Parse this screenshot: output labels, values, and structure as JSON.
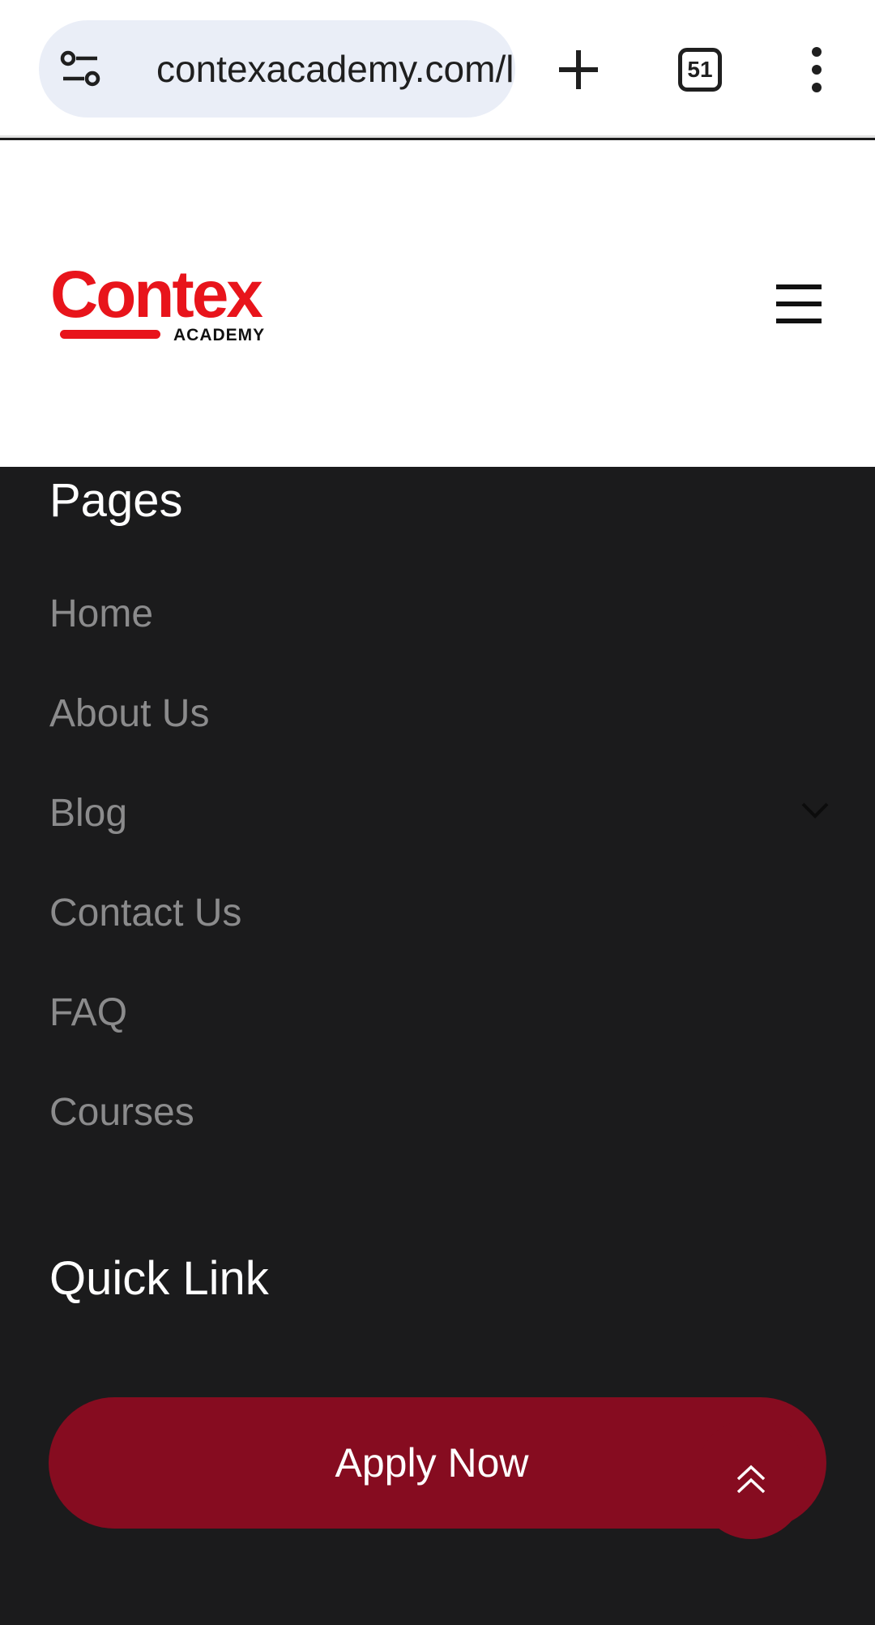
{
  "browser": {
    "url": "contexacademy.com/l",
    "tab_count": "51",
    "icons": [
      "site-settings-icon",
      "new-tab-icon",
      "more-vert-icon"
    ]
  },
  "header": {
    "logo_text": "Contex",
    "logo_subtext": "ACADEMY",
    "brand_color": "#e8141b",
    "menu_icon": "hamburger-icon"
  },
  "pages_section": {
    "title": "Pages",
    "items": [
      {
        "label": "Home"
      },
      {
        "label": "About Us"
      },
      {
        "label": "Blog",
        "has_submenu": true
      },
      {
        "label": "Contact Us"
      },
      {
        "label": "FAQ"
      },
      {
        "label": "Courses"
      }
    ]
  },
  "quick_link_section": {
    "title": "Quick Link"
  },
  "cta": {
    "apply_label": "Apply Now",
    "accent_color": "#860c20"
  },
  "scroll_top_icon": "double-chevron-up-icon",
  "colors": {
    "footer_background": "#1b1b1c",
    "nav_text": "#8b8b8c"
  }
}
